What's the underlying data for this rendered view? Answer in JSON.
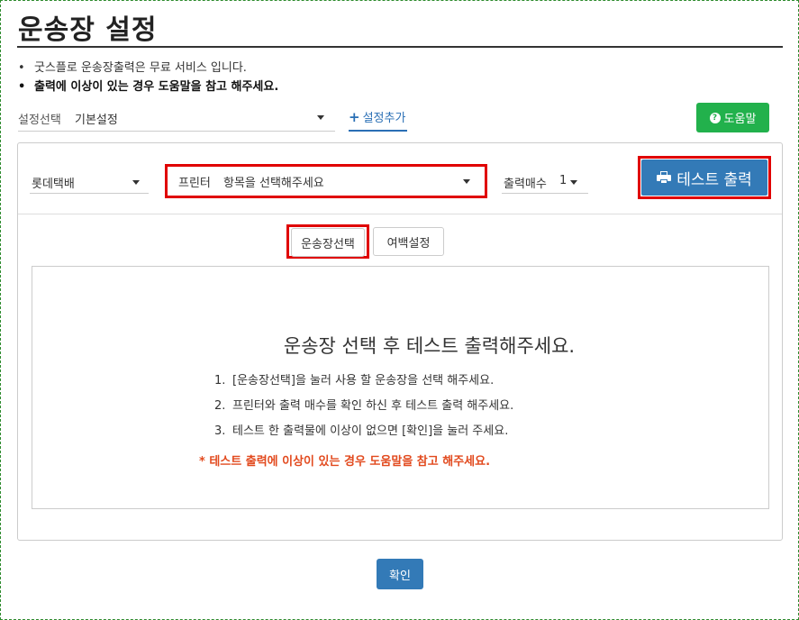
{
  "page": {
    "title": "운송장 설정",
    "notes": [
      "굿스플로 운송장출력은 무료 서비스 입니다.",
      "출력에 이상이 있는 경우 도움말을 참고 해주세요."
    ],
    "bullet": "•"
  },
  "settings": {
    "label": "설정선택",
    "value": "기본설정",
    "add_label": "설정추가",
    "add_icon": "plus-icon",
    "help_label": "도움말",
    "help_icon": "question-circle-icon",
    "help_color": "#22b14c"
  },
  "printer_bar": {
    "courier": "롯데택배",
    "printer_label": "프린터",
    "printer_placeholder": "항목을 선택해주세요",
    "copies_label": "출력매수",
    "copies_value": "1",
    "test_print_label": "테스트 출력",
    "test_print_icon": "printer-icon",
    "accent_color": "#337ab7",
    "highlight_color": "#e00000"
  },
  "tabs": [
    {
      "label": "운송장선택"
    },
    {
      "label": "여백설정"
    }
  ],
  "content": {
    "heading": "운송장 선택 후 테스트 출력해주세요.",
    "steps": [
      {
        "num": "1.",
        "text": "[운송장선택]을 눌러 사용 할 운송장을 선택 해주세요."
      },
      {
        "num": "2.",
        "text": "프린터와 출력 매수를 확인 하신 후 테스트 출력 해주세요."
      },
      {
        "num": "3.",
        "text": "테스트 한 출력물에 이상이 없으면 [확인]을 눌러 주세요."
      }
    ],
    "warning": "* 테스트 출력에 이상이 있는 경우 도움말을 참고 해주세요.",
    "warning_color": "#e24a1e"
  },
  "footer": {
    "confirm_label": "확인"
  }
}
